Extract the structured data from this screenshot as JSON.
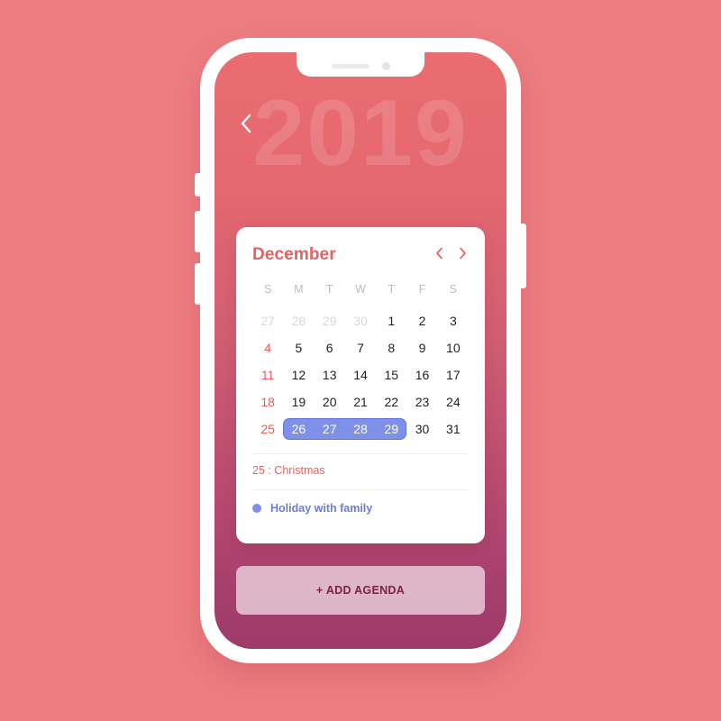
{
  "app": {
    "background_color": "#ed7d80",
    "accent_color": "#e8615f",
    "highlight_color": "#7f90e8"
  },
  "header": {
    "year": "2019",
    "back_icon": "chevron-left-icon"
  },
  "calendar": {
    "month_label": "December",
    "prev_icon": "chevron-left-icon",
    "next_icon": "chevron-right-icon",
    "weekdays": [
      "S",
      "M",
      "T",
      "W",
      "T",
      "F",
      "S"
    ],
    "weeks": [
      [
        {
          "n": "27",
          "muted": true
        },
        {
          "n": "28",
          "muted": true
        },
        {
          "n": "29",
          "muted": true
        },
        {
          "n": "30",
          "muted": true
        },
        {
          "n": "1"
        },
        {
          "n": "2"
        },
        {
          "n": "3"
        }
      ],
      [
        {
          "n": "4",
          "sunday": true
        },
        {
          "n": "5"
        },
        {
          "n": "6"
        },
        {
          "n": "7"
        },
        {
          "n": "8"
        },
        {
          "n": "9"
        },
        {
          "n": "10"
        }
      ],
      [
        {
          "n": "11",
          "sunday": true
        },
        {
          "n": "12"
        },
        {
          "n": "13"
        },
        {
          "n": "14"
        },
        {
          "n": "15"
        },
        {
          "n": "16"
        },
        {
          "n": "17"
        }
      ],
      [
        {
          "n": "18",
          "sunday": true
        },
        {
          "n": "19"
        },
        {
          "n": "20"
        },
        {
          "n": "21"
        },
        {
          "n": "22"
        },
        {
          "n": "23"
        },
        {
          "n": "24"
        }
      ],
      [
        {
          "n": "25",
          "sunday": true
        },
        {
          "n": "26",
          "selected": true
        },
        {
          "n": "27",
          "selected": true
        },
        {
          "n": "28",
          "selected": true
        },
        {
          "n": "29",
          "selected": true
        },
        {
          "n": "30"
        },
        {
          "n": "31"
        }
      ]
    ],
    "selected_range": [
      "26",
      "27",
      "28",
      "29"
    ]
  },
  "agenda": {
    "holiday_note": "25 : Christmas",
    "event_label": "Holiday with family",
    "event_dot": "bullet-dot-icon"
  },
  "actions": {
    "add_agenda_label": "+ ADD AGENDA"
  }
}
